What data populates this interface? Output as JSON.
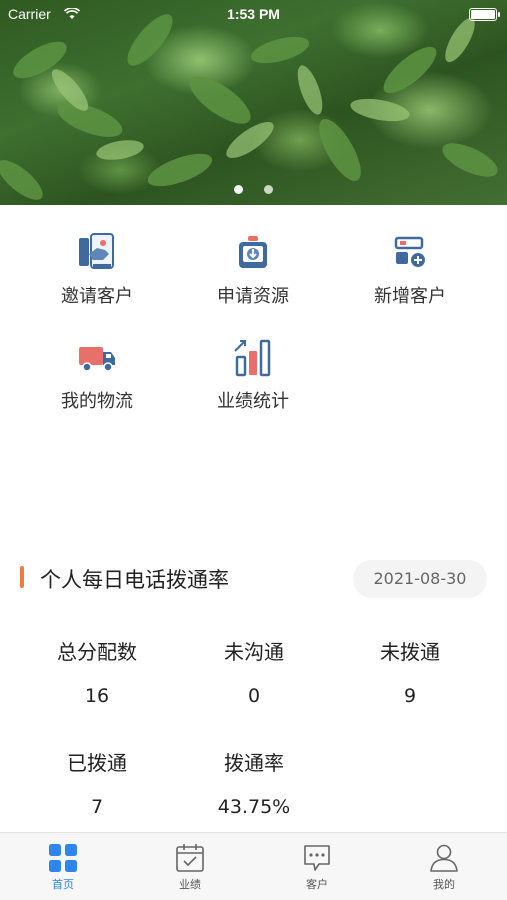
{
  "status_bar": {
    "carrier": "Carrier",
    "time": "1:53 PM"
  },
  "banner": {
    "page_count": 2,
    "active_index": 0
  },
  "menu": {
    "items": [
      {
        "label": "邀请客户",
        "icon": "invite-customer-icon"
      },
      {
        "label": "申请资源",
        "icon": "apply-resource-icon"
      },
      {
        "label": "新增客户",
        "icon": "add-customer-icon"
      },
      {
        "label": "我的物流",
        "icon": "logistics-truck-icon"
      },
      {
        "label": "业绩统计",
        "icon": "performance-chart-icon"
      }
    ]
  },
  "stats_section": {
    "title": "个人每日电话拨通率",
    "date": "2021-08-30",
    "items": [
      {
        "label": "总分配数",
        "value": "16"
      },
      {
        "label": "未沟通",
        "value": "0"
      },
      {
        "label": "未拨通",
        "value": "9"
      },
      {
        "label": "已拨通",
        "value": "7"
      },
      {
        "label": "拨通率",
        "value": "43.75%"
      }
    ]
  },
  "tabbar": {
    "tabs": [
      {
        "label": "首页",
        "icon": "home-grid-icon",
        "active": true
      },
      {
        "label": "业绩",
        "icon": "calendar-check-icon",
        "active": false
      },
      {
        "label": "客户",
        "icon": "chat-bubble-icon",
        "active": false
      },
      {
        "label": "我的",
        "icon": "user-icon",
        "active": false
      }
    ]
  },
  "colors": {
    "accent": "#2f86e8",
    "section_marker": "#f07b3f",
    "icon_blue": "#3f6a9e",
    "icon_red": "#e8706a"
  }
}
